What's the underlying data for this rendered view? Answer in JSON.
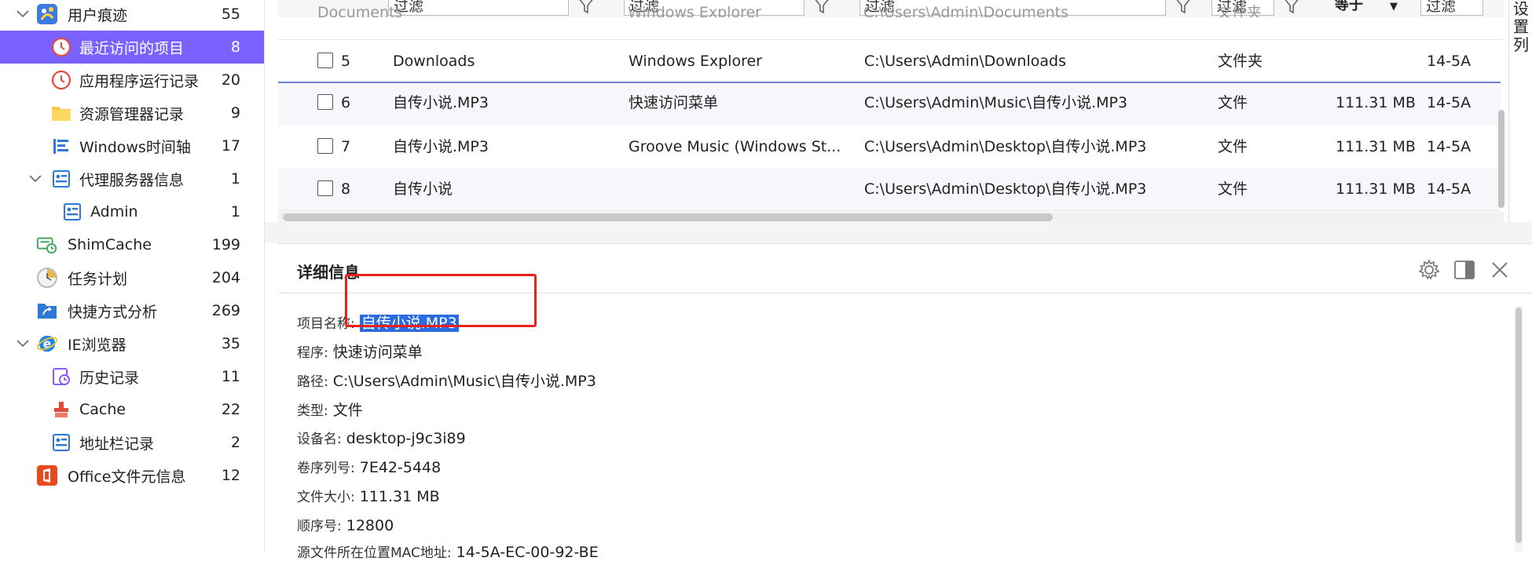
{
  "sidebar": {
    "items": [
      {
        "label": "用户痕迹",
        "count": "55",
        "icon": "user-traces-icon"
      },
      {
        "label": "最近访问的项目",
        "count": "8",
        "icon": "clock-icon"
      },
      {
        "label": "应用程序运行记录",
        "count": "20",
        "icon": "clock-run-icon"
      },
      {
        "label": "资源管理器记录",
        "count": "9",
        "icon": "folder-icon"
      },
      {
        "label": "Windows时间轴",
        "count": "17",
        "icon": "timeline-icon"
      },
      {
        "label": "代理服务器信息",
        "count": "1",
        "icon": "proxy-icon"
      },
      {
        "label": "Admin",
        "count": "1",
        "icon": "profile-card-icon"
      },
      {
        "label": "ShimCache",
        "count": "199",
        "icon": "shimcache-icon"
      },
      {
        "label": "任务计划",
        "count": "204",
        "icon": "task-clock-icon"
      },
      {
        "label": "快捷方式分析",
        "count": "269",
        "icon": "shortcut-folder-icon"
      },
      {
        "label": "IE浏览器",
        "count": "35",
        "icon": "ie-icon"
      },
      {
        "label": "历史记录",
        "count": "11",
        "icon": "history-icon"
      },
      {
        "label": "Cache",
        "count": "22",
        "icon": "cache-icon"
      },
      {
        "label": "地址栏记录",
        "count": "2",
        "icon": "address-bar-icon"
      },
      {
        "label": "Office文件元信息",
        "count": "12",
        "icon": "office-icon"
      }
    ]
  },
  "filters": {
    "placeholder": "过滤",
    "equals_label": "等于",
    "partial_row": [
      "Documents",
      "Windows Explorer",
      "C:\\Users\\Admin\\Documents",
      "文件夹"
    ]
  },
  "table": {
    "rows": [
      {
        "num": "5",
        "name": "Downloads",
        "program": "Windows Explorer",
        "path": "C:\\Users\\Admin\\Downloads",
        "type": "文件夹",
        "size": "",
        "time": "14-5A"
      },
      {
        "num": "6",
        "name": "自传小说.MP3",
        "program": "快速访问菜单",
        "path": "C:\\Users\\Admin\\Music\\自传小说.MP3",
        "type": "文件",
        "size": "111.31 MB",
        "time": "14-5A"
      },
      {
        "num": "7",
        "name": "自传小说.MP3",
        "program": "Groove Music (Windows St...",
        "path": "C:\\Users\\Admin\\Desktop\\自传小说.MP3",
        "type": "文件",
        "size": "111.31 MB",
        "time": "14-5A"
      },
      {
        "num": "8",
        "name": "自传小说",
        "program": "",
        "path": "C:\\Users\\Admin\\Desktop\\自传小说.MP3",
        "type": "文件",
        "size": "111.31 MB",
        "time": "14-5A"
      }
    ]
  },
  "right_strip": {
    "text": "设置列"
  },
  "detail": {
    "title": "详细信息",
    "fields": [
      {
        "key": "项目名称:",
        "value": "自传小说.MP3"
      },
      {
        "key": "程序:",
        "value": "快速访问菜单"
      },
      {
        "key": "路径:",
        "value": "C:\\Users\\Admin\\Music\\自传小说.MP3"
      },
      {
        "key": "类型:",
        "value": "文件"
      },
      {
        "key": "设备名:",
        "value": "desktop-j9c3i89"
      },
      {
        "key": "卷序列号:",
        "value": "7E42-5448"
      },
      {
        "key": "文件大小:",
        "value": "111.31 MB"
      },
      {
        "key": "顺序号:",
        "value": "12800"
      },
      {
        "key": "源文件所在位置MAC地址:",
        "value": "14-5A-EC-00-92-BE"
      }
    ]
  },
  "colors": {
    "accent": "#7b61ff",
    "selection": "#2a6ce0",
    "highlight_box": "#e5231c"
  }
}
